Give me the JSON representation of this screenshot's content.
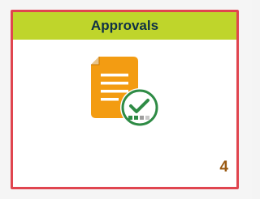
{
  "tile": {
    "title": "Approvals",
    "count": "4",
    "icon": "document-approved-icon",
    "colors": {
      "header": "#bfd52b",
      "title": "#0f3147",
      "border": "#e0454f",
      "count": "#9a5a12",
      "document": "#f39c12",
      "check": "#2e8b45"
    }
  }
}
